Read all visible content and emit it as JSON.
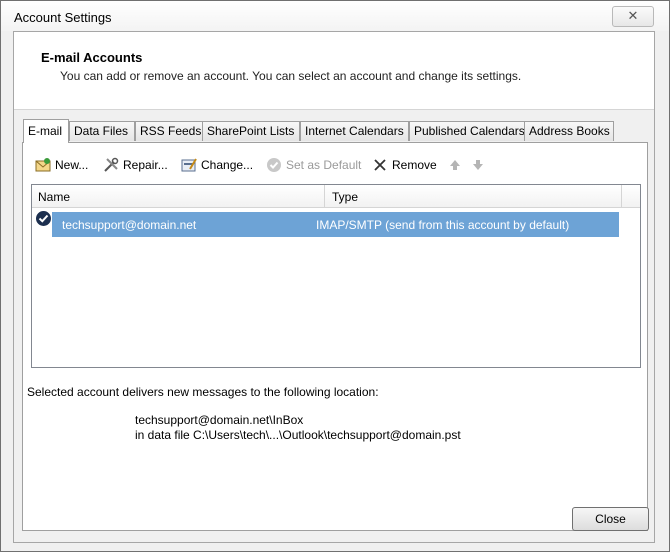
{
  "window": {
    "title": "Account Settings",
    "close_symbol": "✕"
  },
  "header": {
    "title": "E-mail Accounts",
    "subtitle": "You can add or remove an account. You can select an account and change its settings."
  },
  "tabs": [
    {
      "label": "E-mail",
      "active": true
    },
    {
      "label": "Data Files"
    },
    {
      "label": "RSS Feeds"
    },
    {
      "label": "SharePoint Lists"
    },
    {
      "label": "Internet Calendars"
    },
    {
      "label": "Published Calendars"
    },
    {
      "label": "Address Books"
    }
  ],
  "toolbar": {
    "new_label": "New...",
    "repair_label": "Repair...",
    "change_label": "Change...",
    "set_default_label": "Set as Default",
    "remove_label": "Remove"
  },
  "list": {
    "columns": {
      "name": "Name",
      "type": "Type"
    },
    "rows": [
      {
        "name": "techsupport@domain.net",
        "type": "IMAP/SMTP (send from this account by default)",
        "default": true,
        "selected": true
      }
    ]
  },
  "location": {
    "label": "Selected account delivers new messages to the following location:",
    "line1": "techsupport@domain.net\\InBox",
    "line2": "in data file C:\\Users\\tech\\...\\Outlook\\techsupport@domain.pst"
  },
  "footer": {
    "close_label": "Close"
  }
}
